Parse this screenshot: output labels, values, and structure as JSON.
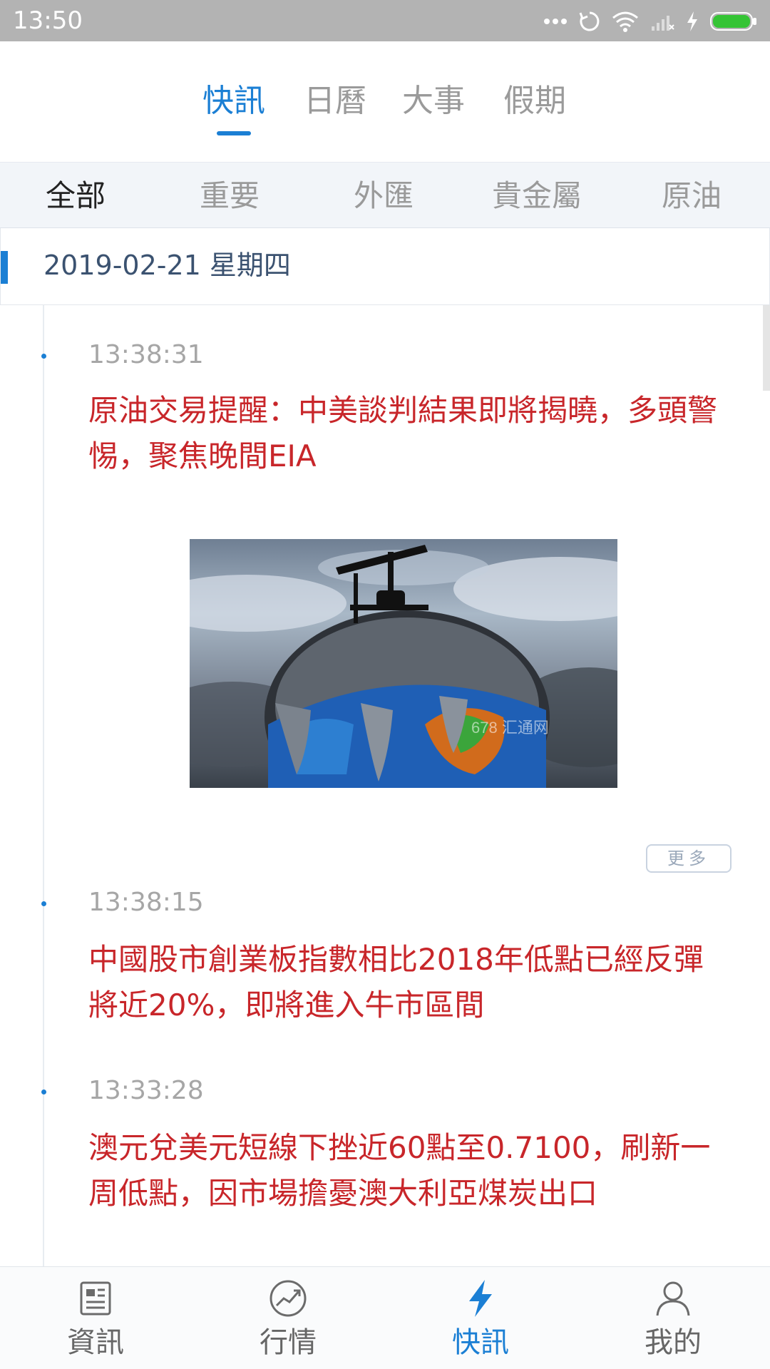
{
  "status_bar": {
    "time": "13:50",
    "icons": [
      "more-dots-icon",
      "sync-icon",
      "wifi-icon",
      "signal-icon",
      "charging-icon",
      "battery-icon"
    ],
    "battery_color": "#35c435"
  },
  "top_tabs": {
    "items": [
      {
        "label": "快訊",
        "active": true
      },
      {
        "label": "日曆",
        "active": false
      },
      {
        "label": "大事",
        "active": false
      },
      {
        "label": "假期",
        "active": false
      }
    ],
    "accent_color": "#1b7fd4"
  },
  "categories": {
    "items": [
      {
        "label": "全部",
        "active": true
      },
      {
        "label": "重要",
        "active": false
      },
      {
        "label": "外匯",
        "active": false
      },
      {
        "label": "貴金屬",
        "active": false
      },
      {
        "label": "原油",
        "active": false
      }
    ]
  },
  "date_header": {
    "text": "2019-02-21 星期四"
  },
  "feed": {
    "items": [
      {
        "time": "13:38:31",
        "title": "原油交易提醒：中美談判結果即將揭曉，多頭警惕，聚焦晚間EIA",
        "has_image": true,
        "image_watermark": "678 汇通网"
      },
      {
        "time": "13:38:15",
        "title": "中國股市創業板指數相比2018年低點已經反彈將近20%，即將進入牛市區間"
      },
      {
        "time": "13:33:28",
        "title": "澳元兌美元短線下挫近60點至0.7100，刷新一周低點，因市場擔憂澳大利亞煤炭出口"
      }
    ],
    "more_label": "更多",
    "headline_color": "#c8262a"
  },
  "bottom_nav": {
    "items": [
      {
        "label": "資訊",
        "icon": "news-icon",
        "active": false
      },
      {
        "label": "行情",
        "icon": "market-chart-icon",
        "active": false
      },
      {
        "label": "快訊",
        "icon": "lightning-icon",
        "active": true
      },
      {
        "label": "我的",
        "icon": "user-icon",
        "active": false
      }
    ]
  }
}
